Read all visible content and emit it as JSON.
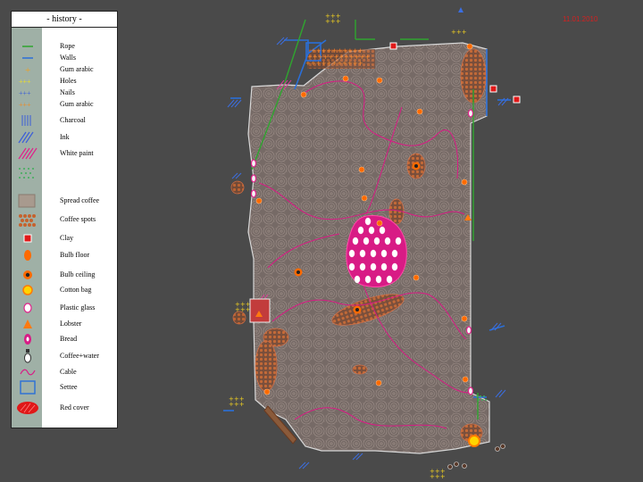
{
  "legend": {
    "title": "- history -",
    "items": [
      {
        "id": "rope",
        "label": "Rope",
        "icon": "rope-icon"
      },
      {
        "id": "walls",
        "label": "Walls",
        "icon": "walls-icon"
      },
      {
        "id": "gum1",
        "label": "Gum arabic",
        "icon": "gum-arabic-icon"
      },
      {
        "id": "holes",
        "label": "Holes",
        "icon": "holes-icon"
      },
      {
        "id": "nails",
        "label": "Nails",
        "icon": "nails-icon"
      },
      {
        "id": "gum2",
        "label": "Gum arabic",
        "icon": "gum-arabic-dots-icon"
      },
      {
        "id": "charcoal",
        "label": "Charcoal",
        "icon": "charcoal-icon"
      },
      {
        "id": "ink",
        "label": "Ink",
        "icon": "ink-icon"
      },
      {
        "id": "whitepaint",
        "label": "White paint",
        "icon": "white-paint-icon"
      },
      {
        "id": "greenpattern",
        "label": "",
        "icon": "green-pattern-icon"
      },
      {
        "id": "spreadcoffee",
        "label": "Spread coffee",
        "icon": "spread-coffee-icon"
      },
      {
        "id": "coffeespots",
        "label": "Coffee spots",
        "icon": "coffee-spots-icon"
      },
      {
        "id": "clay",
        "label": "Clay",
        "icon": "clay-icon"
      },
      {
        "id": "bulbfloor",
        "label": "Bulb floor",
        "icon": "bulb-floor-icon"
      },
      {
        "id": "bulbceiling",
        "label": "Bulb ceiling",
        "icon": "bulb-ceiling-icon"
      },
      {
        "id": "cottonbag",
        "label": "Cotton bag",
        "icon": "cotton-bag-icon"
      },
      {
        "id": "plasticglass",
        "label": "Plastic glass",
        "icon": "plastic-glass-icon"
      },
      {
        "id": "lobster",
        "label": "Lobster",
        "icon": "lobster-icon"
      },
      {
        "id": "bread",
        "label": "Bread",
        "icon": "bread-icon"
      },
      {
        "id": "coffeewater",
        "label": "Coffee+water",
        "icon": "coffee-water-icon"
      },
      {
        "id": "cable",
        "label": "Cable",
        "icon": "cable-icon"
      },
      {
        "id": "settee",
        "label": "Settee",
        "icon": "settee-icon"
      },
      {
        "id": "redcover",
        "label": "Red cover",
        "icon": "red-cover-icon"
      }
    ]
  },
  "timestamp": "11.01.2010",
  "colors": {
    "background": "#4a4a4a",
    "floor": "#7a6e69",
    "coffee": "#c6622d",
    "paint": "#e0208a",
    "clay": "#e01818",
    "bulb": "#ff7a10",
    "walls": "#2a6fd8",
    "rope": "#2fa52f",
    "gum": "#f0d020"
  }
}
